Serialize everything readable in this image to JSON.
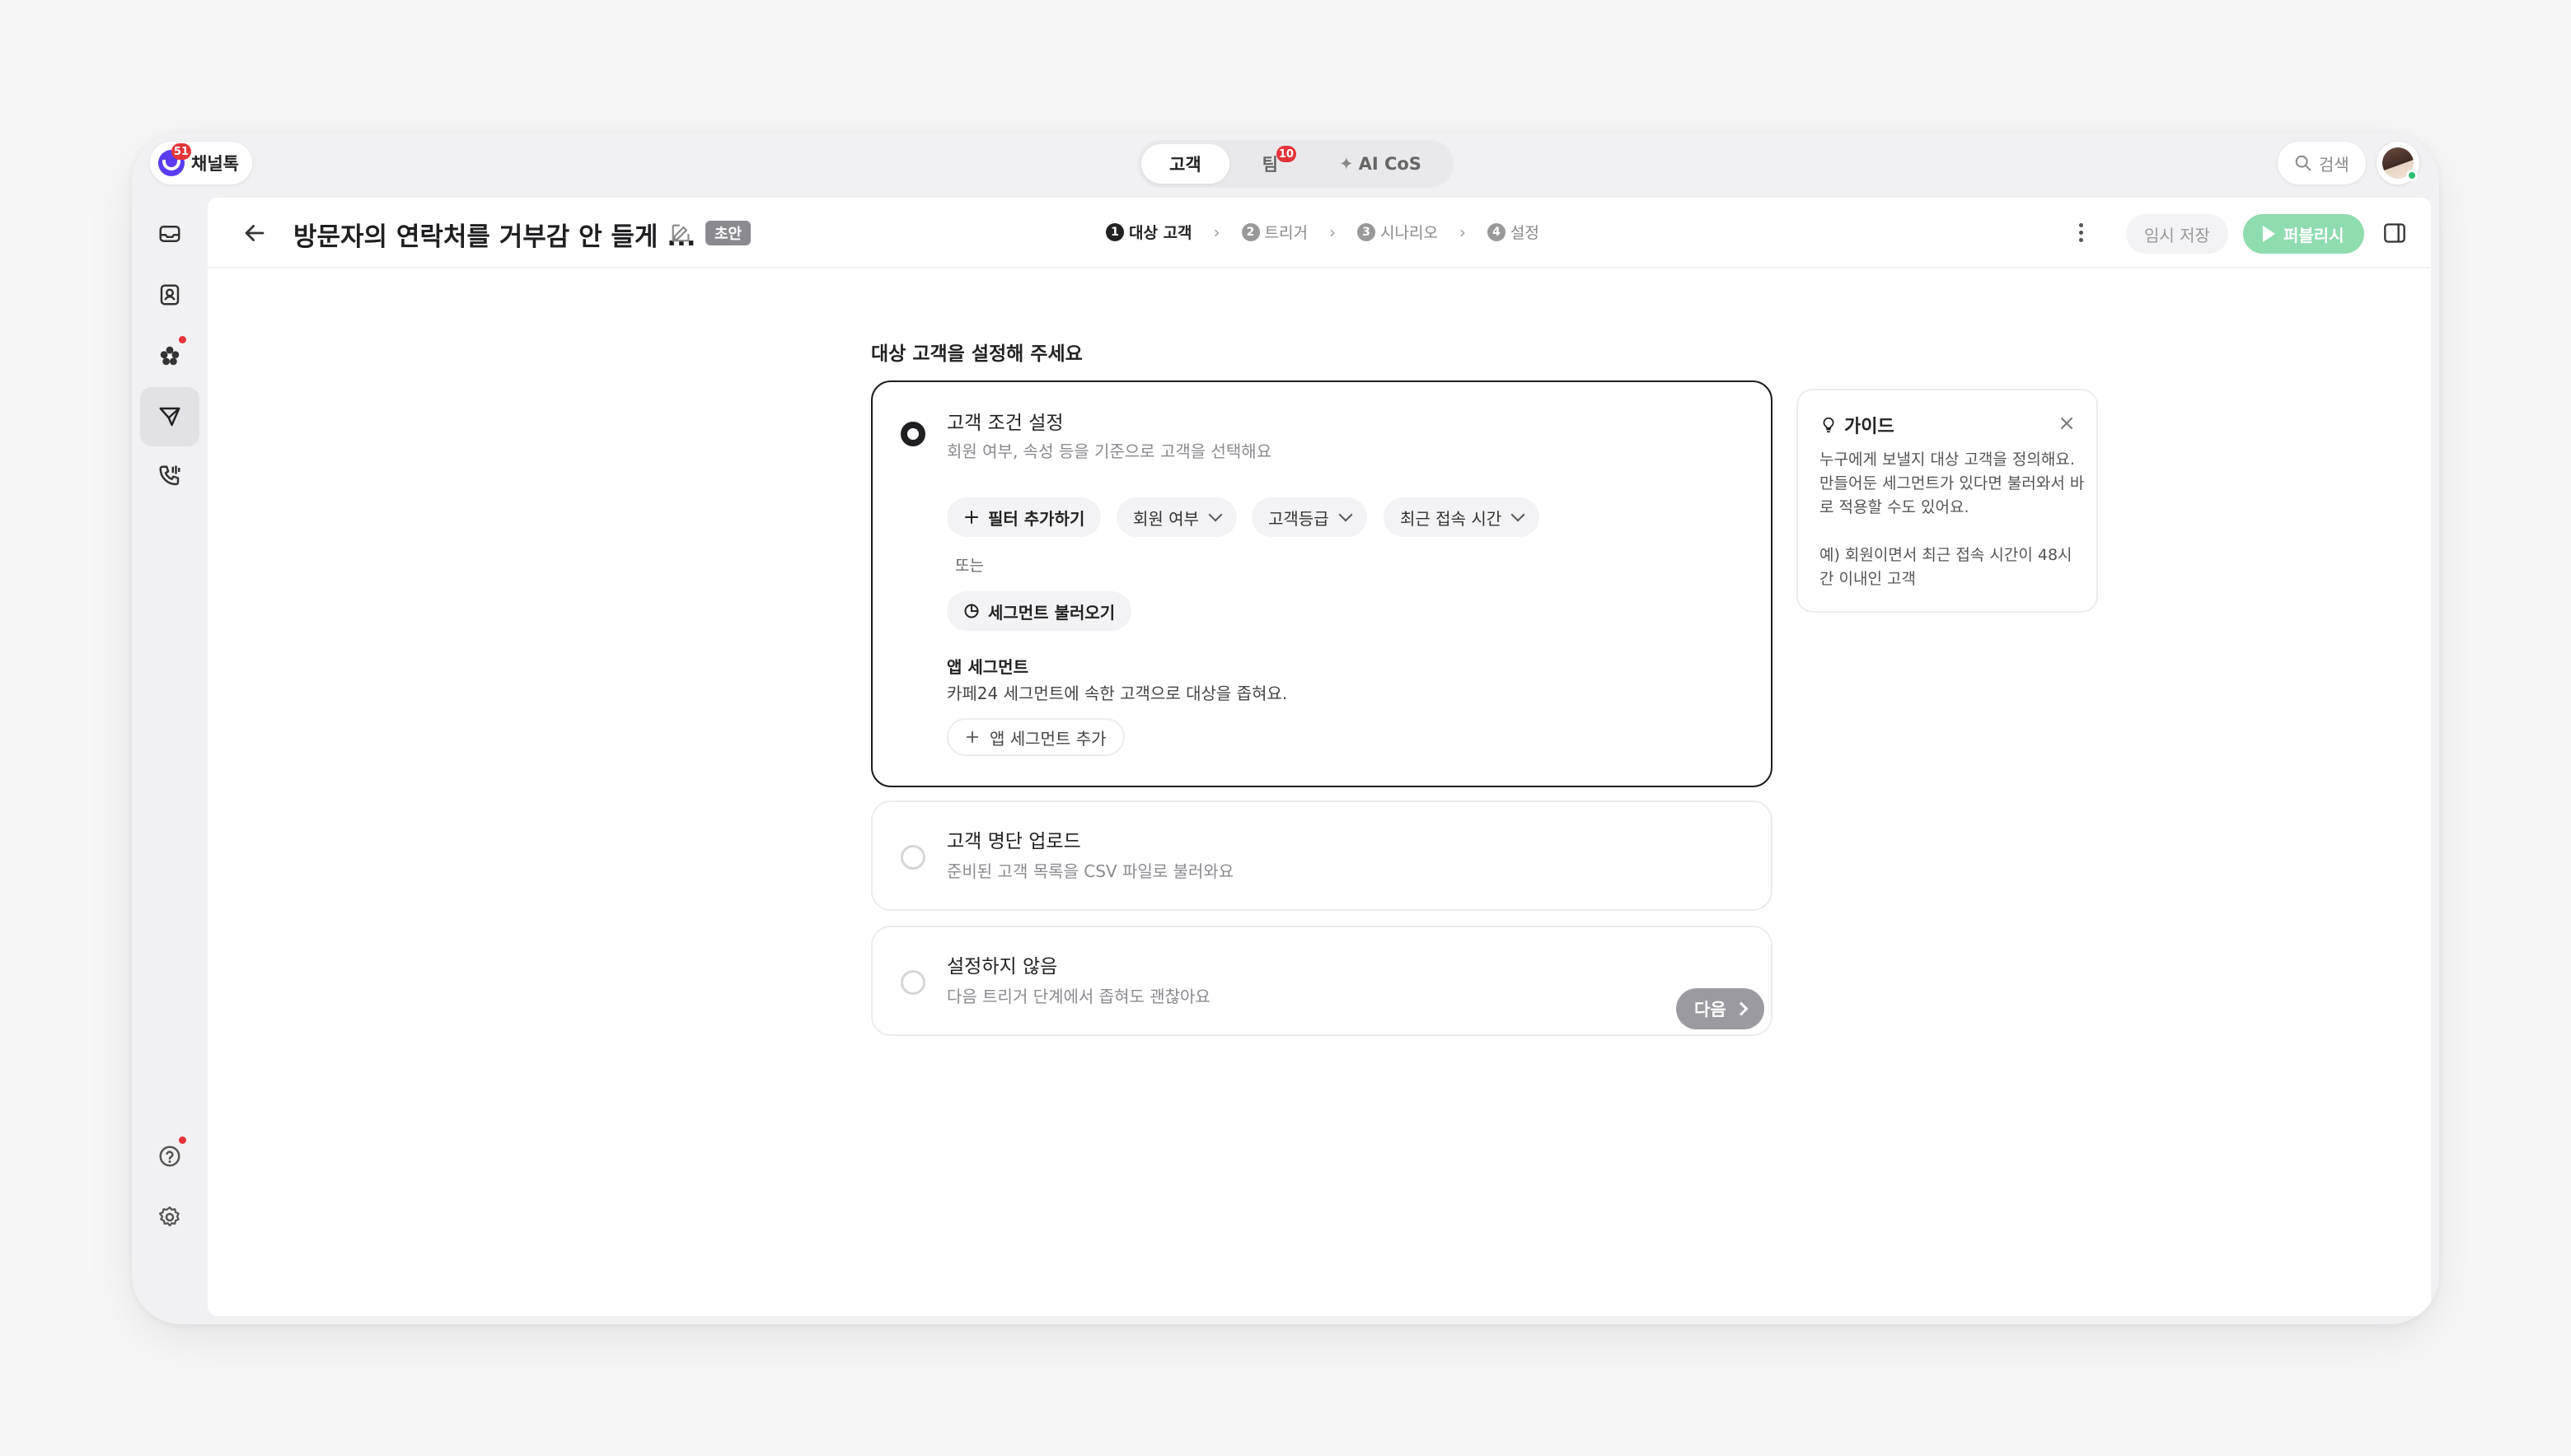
{
  "brand": {
    "name": "채널톡",
    "badge": "51"
  },
  "top_tabs": [
    {
      "label": "고객",
      "active": true
    },
    {
      "label": "팀",
      "badge": "10"
    },
    {
      "label": "AI CoS"
    }
  ],
  "search": {
    "label": "검색"
  },
  "header": {
    "title": "방문자의 연락처를 거부감 안 들게 ...",
    "status_badge": "초안",
    "steps": [
      {
        "num": "1",
        "label": "대상 고객",
        "active": true
      },
      {
        "num": "2",
        "label": "트리거"
      },
      {
        "num": "3",
        "label": "시나리오"
      },
      {
        "num": "4",
        "label": "설정"
      }
    ],
    "temp_save": "임시 저장",
    "publish": "퍼블리시"
  },
  "main": {
    "section_label": "대상 고객을 설정해 주세요",
    "option_conditions": {
      "title": "고객 조건 설정",
      "desc": "회원 여부, 속성 등을 기준으로 고객을 선택해요",
      "add_filter": "필터 추가하기",
      "filters": [
        "회원 여부",
        "고객등급",
        "최근 접속 시간"
      ],
      "or_text": "또는",
      "load_segment": "세그먼트 불러오기",
      "app_segment_title": "앱 세그먼트",
      "app_segment_desc": "카페24 세그먼트에 속한 고객으로 대상을 좁혀요.",
      "add_app_segment": "앱 세그먼트 추가"
    },
    "option_upload": {
      "title": "고객 명단 업로드",
      "desc": "준비된 고객 목록을 CSV 파일로 불러와요"
    },
    "option_none": {
      "title": "설정하지 않음",
      "desc": "다음 트리거 단계에서 좁혀도 괜찮아요"
    },
    "next": "다음"
  },
  "guide": {
    "title": "가이드",
    "body": "누구에게 보낼지 대상 고객을 정의해요. 만들어둔 세그먼트가 있다면 불러와서 바로 적용할 수도 있어요.",
    "example": "예) 회원이면서 최근 접속 시간이 48시간 이내인 고객"
  },
  "colors": {
    "brand": "#5b3cf4",
    "publish": "#8fdcaf",
    "badge": "#e5343a",
    "online": "#2fbf71"
  }
}
